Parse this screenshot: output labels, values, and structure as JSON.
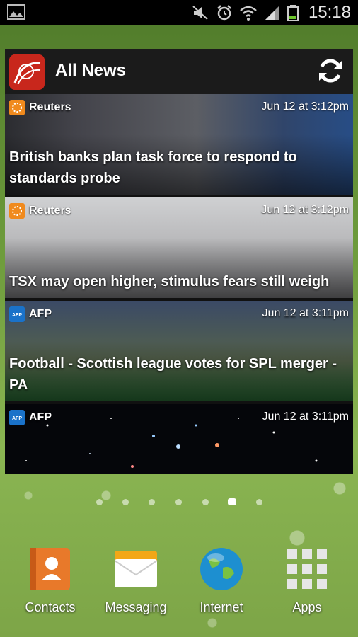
{
  "status_bar": {
    "time": "15:18"
  },
  "widget": {
    "title": "All News",
    "articles": [
      {
        "source": "Reuters",
        "time": "Jun 12 at 3:12pm",
        "headline": "British banks plan task force to respond to standards probe"
      },
      {
        "source": "Reuters",
        "time": "Jun 12 at 3:12pm",
        "headline": "TSX may open higher, stimulus fears still weigh"
      },
      {
        "source": "AFP",
        "time": "Jun 12 at 3:11pm",
        "headline": "Football - Scottish league votes for SPL merger - PA"
      },
      {
        "source": "AFP",
        "time": "Jun 12 at 3:11pm",
        "headline": ""
      }
    ]
  },
  "home_pages": {
    "count": 7,
    "active_index": 5
  },
  "dock": {
    "apps": [
      {
        "label": "Contacts",
        "icon": "contacts-icon"
      },
      {
        "label": "Messaging",
        "icon": "messaging-icon"
      },
      {
        "label": "Internet",
        "icon": "internet-icon"
      },
      {
        "label": "Apps",
        "icon": "apps-grid-icon"
      }
    ]
  }
}
